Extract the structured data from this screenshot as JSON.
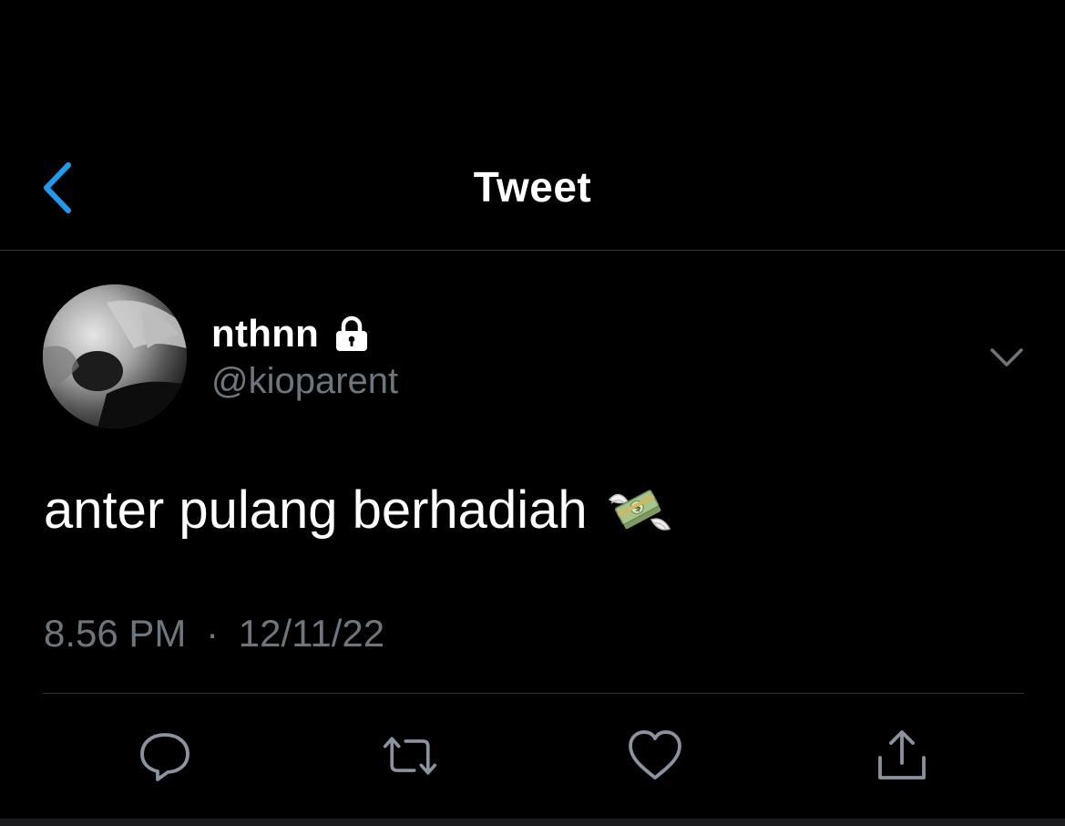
{
  "header": {
    "title": "Tweet",
    "back_icon": "chevron-left-icon"
  },
  "tweet": {
    "author": {
      "display_name": "nthnn",
      "handle": "@kioparent",
      "protected_icon": "lock-icon"
    },
    "text": "anter pulang berhadiah",
    "emoji": "money-with-wings-emoji",
    "time": "8.56 PM",
    "separator": "·",
    "date": "12/11/22",
    "more_icon": "chevron-down-icon"
  },
  "actions": [
    {
      "name": "reply",
      "icon": "speech-bubble-icon"
    },
    {
      "name": "retweet",
      "icon": "retweet-icon"
    },
    {
      "name": "like",
      "icon": "heart-icon"
    },
    {
      "name": "share",
      "icon": "share-icon"
    }
  ],
  "colors": {
    "background": "#000000",
    "text": "#ffffff",
    "secondary_text": "#6e767d",
    "accent": "#1d9bf0",
    "divider": "#2f3336"
  }
}
